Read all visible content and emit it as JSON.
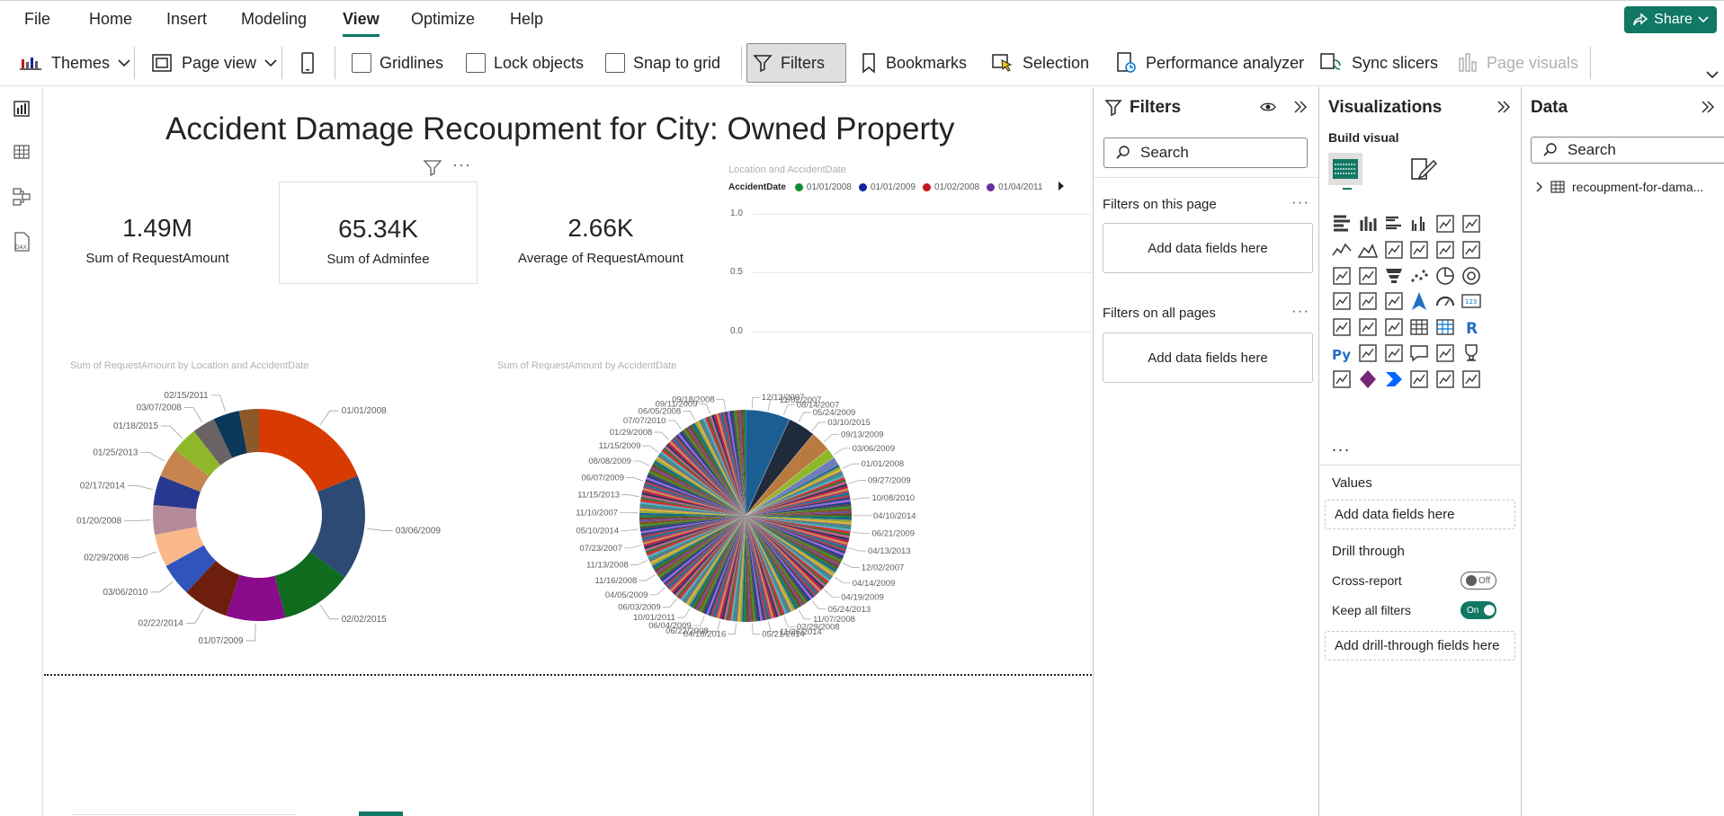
{
  "menu": {
    "items": [
      "File",
      "Home",
      "Insert",
      "Modeling",
      "View",
      "Optimize",
      "Help"
    ],
    "active": "View",
    "share_label": "Share"
  },
  "ribbon": {
    "themes": "Themes",
    "page_view": "Page view",
    "gridlines": "Gridlines",
    "lock_objects": "Lock objects",
    "snap_to_grid": "Snap to grid",
    "filters": "Filters",
    "bookmarks": "Bookmarks",
    "selection": "Selection",
    "performance_analyzer": "Performance analyzer",
    "sync_slicers": "Sync slicers",
    "page_visuals": "Page visuals"
  },
  "report": {
    "title": "Accident Damage Recoupment for City: Owned Property",
    "cards": [
      {
        "value": "1.49M",
        "label": "Sum of RequestAmount"
      },
      {
        "value": "65.34K",
        "label": "Sum of Adminfee"
      },
      {
        "value": "2.66K",
        "label": "Average of RequestAmount"
      }
    ]
  },
  "line_chart": {
    "title": "Location and AccidentDate",
    "legend_title": "AccidentDate",
    "legend": [
      {
        "label": "01/01/2008",
        "color": "#118C2E"
      },
      {
        "label": "01/01/2009",
        "color": "#12239E"
      },
      {
        "label": "01/02/2008",
        "color": "#C4161C"
      },
      {
        "label": "01/04/2011",
        "color": "#6B2FA0"
      }
    ],
    "y_ticks": [
      "1.0",
      "0.5",
      "0.0"
    ]
  },
  "chart_data": [
    {
      "type": "pie",
      "title": "Sum of RequestAmount by Location and AccidentDate",
      "subtype": "donut",
      "slices": [
        {
          "label": "01/01/2008",
          "value": 19,
          "color": "#D83B01"
        },
        {
          "label": "03/06/2009",
          "value": 16,
          "color": "#2C4A74"
        },
        {
          "label": "02/02/2015",
          "value": 11,
          "color": "#0F6B1E"
        },
        {
          "label": "01/07/2009",
          "value": 9,
          "color": "#8A0A8C"
        },
        {
          "label": "02/22/2014",
          "value": 7,
          "color": "#6E1E0D"
        },
        {
          "label": "03/06/2010",
          "value": 5,
          "color": "#3153BC"
        },
        {
          "label": "02/29/2008",
          "value": 5,
          "color": "#F9B98B"
        },
        {
          "label": "01/20/2008",
          "value": 4.5,
          "color": "#B58A9A"
        },
        {
          "label": "02/17/2014",
          "value": 4.5,
          "color": "#28388F"
        },
        {
          "label": "01/25/2013",
          "value": 4.5,
          "color": "#C7844F"
        },
        {
          "label": "01/18/2015",
          "value": 4,
          "color": "#8EB82A"
        },
        {
          "label": "03/07/2008",
          "value": 3.5,
          "color": "#6A6365"
        },
        {
          "label": "02/15/2011",
          "value": 4,
          "color": "#0B3758"
        },
        {
          "label": "",
          "value": 3,
          "color": "#8C5A2A"
        }
      ]
    },
    {
      "type": "pie",
      "title": "Sum of RequestAmount by AccidentDate",
      "major_slices": [
        {
          "value": 6.5,
          "color": "#1B5E93"
        },
        {
          "value": 4,
          "color": "#1F2A3B"
        },
        {
          "value": 3,
          "color": "#B97A3F"
        },
        {
          "value": 1.5,
          "color": "#8EB82A"
        },
        {
          "value": 1.2,
          "color": "#6F7EB8"
        }
      ],
      "many_slices_count": 240,
      "labels": [
        "12/12/2007",
        "11/02/2007",
        "08/14/2007",
        "05/24/2009",
        "03/10/2015",
        "09/13/2009",
        "03/06/2009",
        "01/01/2008",
        "09/27/2009",
        "10/08/2010",
        "04/10/2014",
        "06/21/2009",
        "04/13/2013",
        "12/02/2007",
        "04/14/2009",
        "04/19/2009",
        "05/24/2013",
        "11/07/2008",
        "02/29/2008",
        "11/26/2014",
        "05/21/2014",
        "04/18/2016",
        "06/22/2008",
        "06/04/2009",
        "10/01/2011",
        "06/03/2009",
        "04/05/2009",
        "11/16/2008",
        "11/13/2008",
        "07/23/2007",
        "05/10/2014",
        "11/10/2007",
        "11/15/2013",
        "06/07/2009",
        "08/08/2009",
        "11/15/2009",
        "01/29/2008",
        "07/07/2010",
        "06/05/2008",
        "09/11/2009",
        "09/18/2008"
      ]
    }
  ],
  "filters_pane": {
    "title": "Filters",
    "search_placeholder": "Search",
    "on_this_page": "Filters on this page",
    "on_all_pages": "Filters on all pages",
    "add_fields": "Add data fields here"
  },
  "viz_pane": {
    "title": "Visualizations",
    "build_visual": "Build visual",
    "more": "...",
    "values_label": "Values",
    "add_fields": "Add data fields here",
    "drill_through": "Drill through",
    "cross_report": "Cross-report",
    "cross_report_state": "Off",
    "keep_all_filters": "Keep all filters",
    "keep_all_filters_state": "On",
    "add_drillthrough": "Add drill-through fields here"
  },
  "data_pane": {
    "title": "Data",
    "search_placeholder": "Search",
    "table_name": "recoupment-for-dama..."
  }
}
